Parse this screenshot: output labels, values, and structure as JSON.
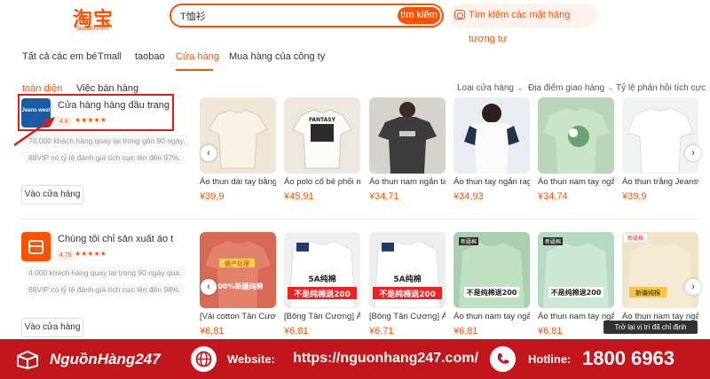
{
  "header": {
    "logo": "淘宝",
    "logo_sub": "Taobao.com",
    "search_value": "T恤衫",
    "search_button": "tìm kiếm",
    "image_search_label": "Tìm kiếm các mặt hàng tương tự"
  },
  "tabs": [
    "Tất cả các em bé",
    "Tmall",
    "taobao",
    "Cửa hàng",
    "Mua hàng của công ty"
  ],
  "subtabs": [
    "toàn diện",
    "Việc bán hàng"
  ],
  "filters": [
    "Loại cửa hàng",
    "Địa điểm giao hàng",
    "Tỷ lệ phản hồi tích cực"
  ],
  "shops": [
    {
      "name": "Cửa hàng hàng đầu trang phục ...",
      "logo_text": "Jeans west",
      "rating": "4.8",
      "stars": "★★★★★",
      "stat1": "70.000 khách hàng quay lại trong gần 90 ngày.",
      "stat2": "88VIP có tỷ lệ đánh giá tích cực lên đến 97%.",
      "visit_label": "Vào cửa hàng",
      "products": [
        {
          "title": "Áo thun dài tay bằng ...",
          "price": "¥39,9",
          "color": "#efe6d8"
        },
        {
          "title": "Áo polo cổ bẻ phối m...",
          "price": "¥45,91",
          "color": "#ece8df",
          "tag": "FANTASY"
        },
        {
          "title": "Áo thun nam ngắn tay ...",
          "price": "¥34,71",
          "color": "#d6d3cf"
        },
        {
          "title": "Áo thun tay ngắn ragl...",
          "price": "¥34,93",
          "color": "#e9edf2"
        },
        {
          "title": "Áo thun nam tay ngắn ...",
          "price": "¥34,74",
          "color": "#b9d6bb"
        },
        {
          "title": "Áo thun trắng Jeansw...",
          "price": "¥39,9",
          "color": "#f1f2f2"
        }
      ]
    },
    {
      "name": "Chúng tôi chỉ sản xuất áo thun ...",
      "rating": "4.78",
      "stars": "★★★★★",
      "stat1": "4.000 khách hàng quay lại trong 90 ngày qua.",
      "stat2": "88VIP có tỷ lệ đánh giá tích cực lên đến 98%.",
      "visit_label": "Vào cửa hàng",
      "products": [
        {
          "title": "[Vải cotton Tân Cương] ...",
          "price": "¥6,81",
          "color": "#d86a55",
          "tag": "100%新疆纯棉",
          "badge": "做产处理"
        },
        {
          "title": "[Bông Tân Cương] Á...",
          "price": "¥6,81",
          "color": "#eef0f2",
          "tag": "不是纯棉退200",
          "badge": "5A纯棉"
        },
        {
          "title": "[Bông Tân Cương] Á...",
          "price": "¥6,71",
          "color": "#eceef0",
          "tag": "不是纯棉退200",
          "badge": "5A纯棉"
        },
        {
          "title": "Áo thun nam tay ngắn ...",
          "price": "¥6,81",
          "color": "#a9cfae",
          "tag": "不是纯棉退200",
          "badge": "新疆棉"
        },
        {
          "title": "Áo thun nam tay ngắn ...",
          "price": "¥6,81",
          "color": "#b6d9c4",
          "tag": "不是纯棉退200",
          "badge": "新疆棉"
        },
        {
          "title": "Áo thun nam tay ngắn ...",
          "price": "¥6,81",
          "color": "#efe3c8",
          "tag": "新疆纯棉",
          "badge": "新疆棉"
        }
      ]
    }
  ],
  "tooltip": "Trở lại vị trí đã chỉ định",
  "footer": {
    "brand": "NguồnHàng247",
    "website_label": "Website:",
    "website_value": "https://nguonhang247.com/",
    "hotline_label": "Hotline:",
    "hotline_value": "1800 6963"
  },
  "colors": {
    "accent": "#ff5000",
    "footer": "#c3161c",
    "highlight": "#e11a1a"
  }
}
